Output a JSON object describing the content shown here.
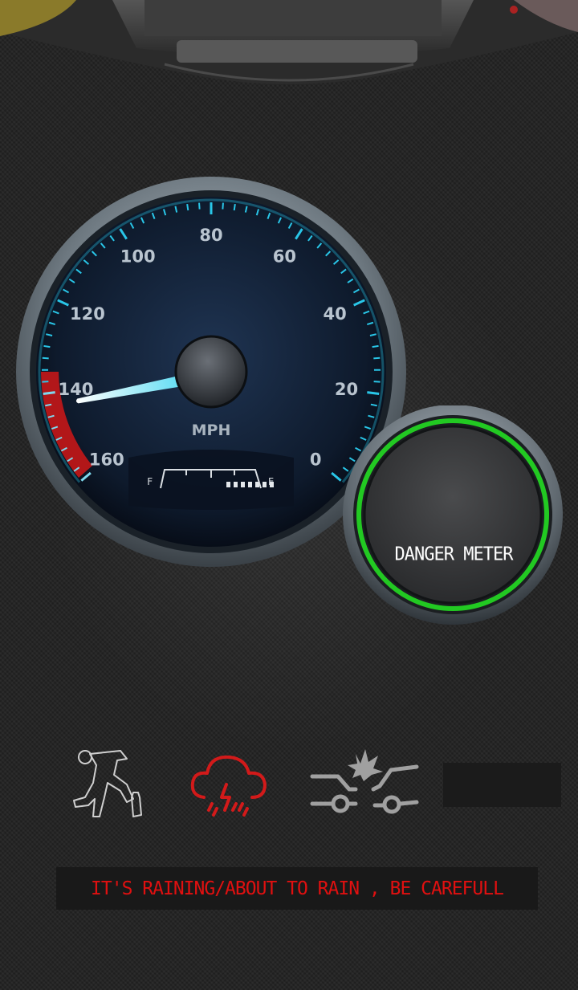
{
  "speedometer": {
    "unit_label": "MPH",
    "scale_labels": [
      "0",
      "20",
      "40",
      "60",
      "80",
      "100",
      "120",
      "140",
      "160"
    ],
    "speed_value": 143,
    "fuel": {
      "full_label": "F",
      "empty_label": "E",
      "level_fraction": 0.4
    }
  },
  "danger_meter": {
    "label": "DANGER METER",
    "ring_color": "#22c922"
  },
  "status_icons": [
    {
      "name": "drunk-person-icon",
      "active": false
    },
    {
      "name": "rain-storm-icon",
      "active": true,
      "color": "#d21a1a"
    },
    {
      "name": "car-crash-icon",
      "active": false
    },
    {
      "name": "empty-slot",
      "active": false
    }
  ],
  "alert": {
    "message": "IT'S RAINING/ABOUT TO RAIN , BE CAREFULL",
    "color": "#e01010"
  }
}
